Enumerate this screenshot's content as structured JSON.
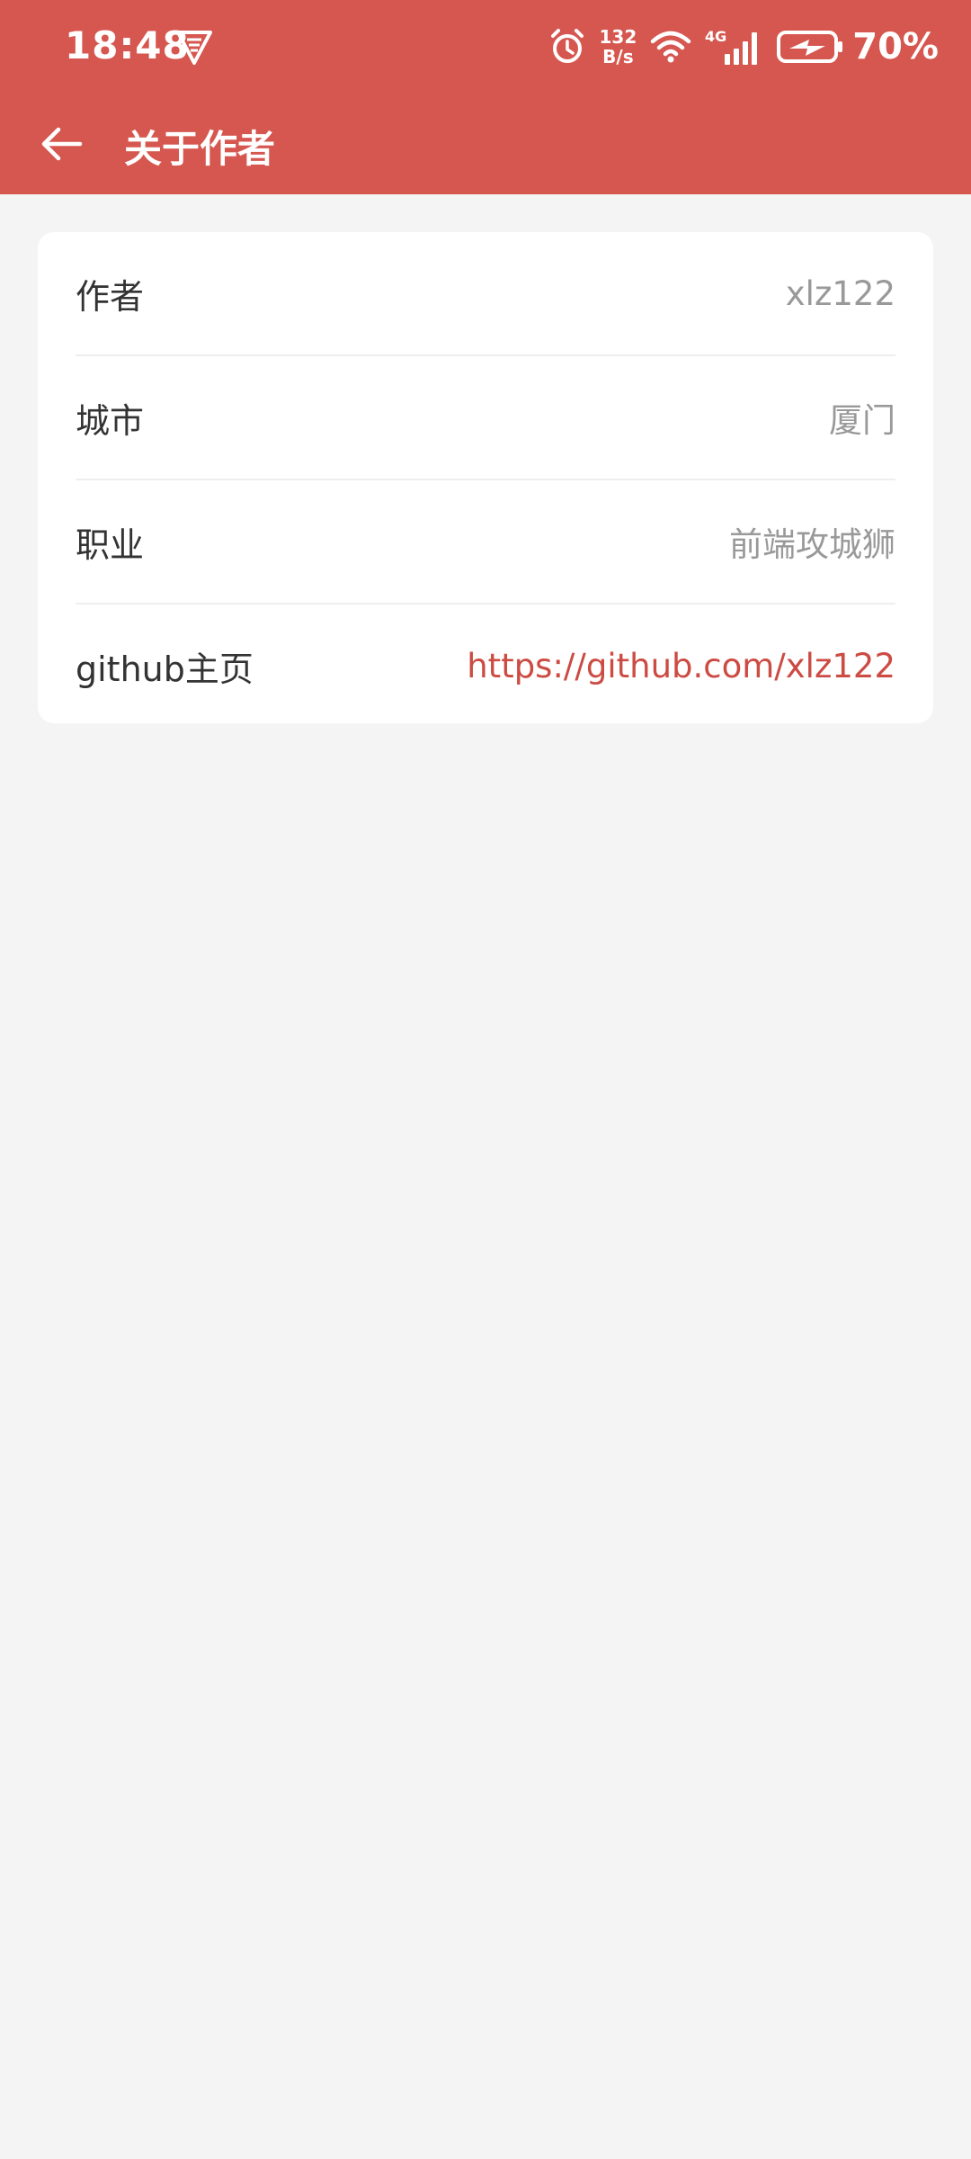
{
  "status_bar": {
    "time": "18:48",
    "net_speed_value": "132",
    "net_speed_unit": "B/s",
    "network_type": "4G",
    "battery_percent": "70%",
    "icons": [
      "vpn-shield-icon",
      "alarm-icon",
      "wifi-icon",
      "cellular-signal-icon",
      "battery-charging-icon"
    ]
  },
  "app_bar": {
    "title": "关于作者",
    "back_icon": "arrow-left-icon"
  },
  "colors": {
    "accent": "#d6574f",
    "link": "#cc4b43",
    "background": "#f4f4f4",
    "card": "#ffffff",
    "label_text": "#333333",
    "value_text": "#999999"
  },
  "info_rows": [
    {
      "label": "作者",
      "value": "xlz122"
    },
    {
      "label": "城市",
      "value": "厦门"
    },
    {
      "label": "职业",
      "value": "前端攻城狮"
    },
    {
      "label": "github主页",
      "value": "https://github.com/xlz122"
    }
  ]
}
